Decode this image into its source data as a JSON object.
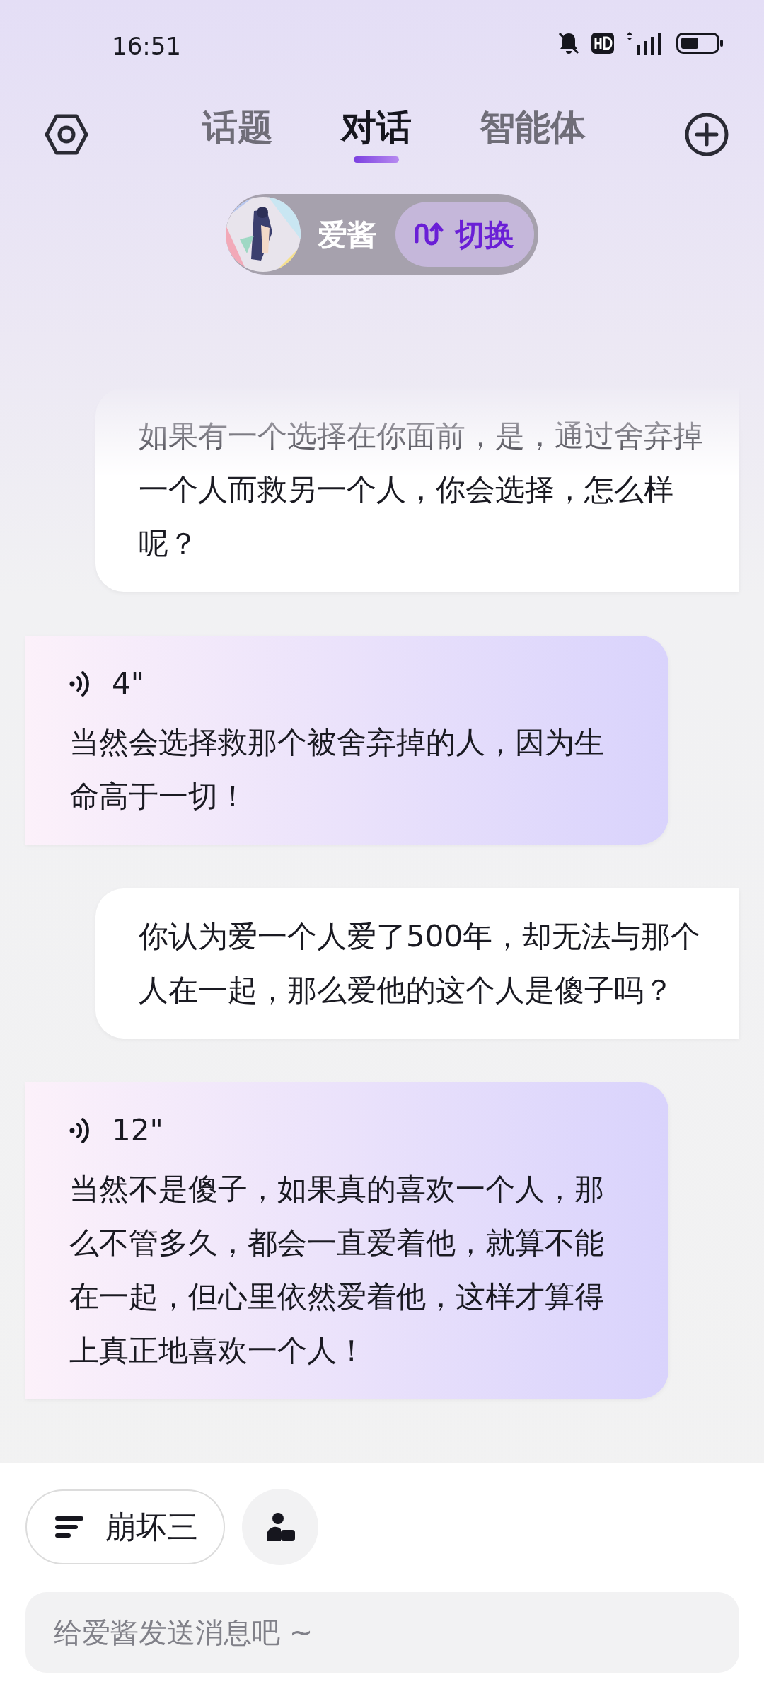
{
  "status_bar": {
    "time": "16:51"
  },
  "tabs": [
    {
      "label": "话题",
      "selected": false
    },
    {
      "label": "对话",
      "selected": true
    },
    {
      "label": "智能体",
      "selected": false
    }
  ],
  "agent": {
    "name": "爱酱",
    "switch_label": "切换"
  },
  "messages": [
    {
      "kind": "user",
      "text": "如果有一个选择在你面前，是，通过舍弃掉一个人而救另一个人，你会选择，怎么样呢？"
    },
    {
      "kind": "bot",
      "duration": "4\"",
      "text": "当然会选择救那个被舍弃掉的人，因为生命高于一切！"
    },
    {
      "kind": "user",
      "text": "你认为爱一个人爱了500年，却无法与那个人在一起，那么爱他的这个人是傻子吗？"
    },
    {
      "kind": "bot",
      "duration": "12\"",
      "text": "当然不是傻子，如果真的喜欢一个人，那么不管多久，都会一直爱着他，就算不能在一起，但心里依然爱着他，这样才算得上真正地喜欢一个人！"
    }
  ],
  "topic_chip": {
    "label": "崩坏三"
  },
  "input": {
    "placeholder": "给爱酱发送消息吧 ~"
  }
}
